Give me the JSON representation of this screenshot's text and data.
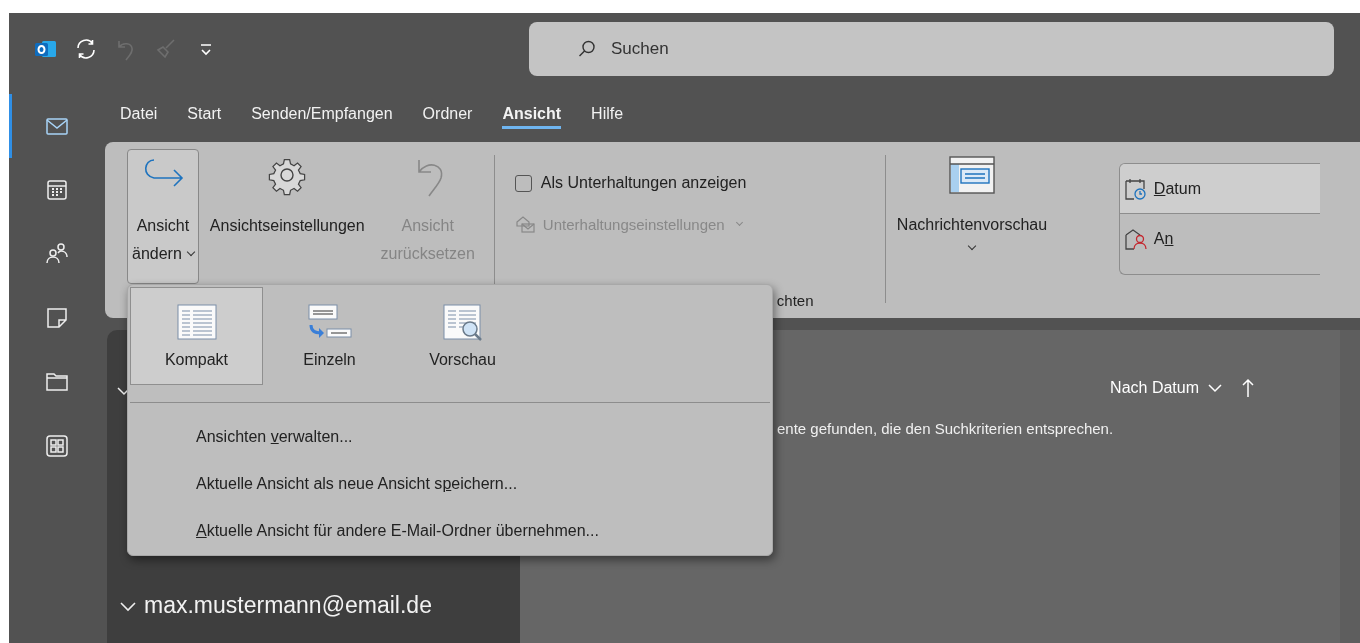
{
  "title_bar": {
    "quick_access": [
      {
        "kind": "sync",
        "disabled": false
      },
      {
        "kind": "undo",
        "disabled": true
      },
      {
        "kind": "brush",
        "disabled": true
      },
      {
        "kind": "customize",
        "disabled": false
      }
    ],
    "search": {
      "placeholder": "Suchen"
    }
  },
  "nav": [
    {
      "kind": "mail",
      "selected": true
    },
    {
      "kind": "calendar",
      "selected": false
    },
    {
      "kind": "people",
      "selected": false
    },
    {
      "kind": "notes",
      "selected": false
    },
    {
      "kind": "folder",
      "selected": false
    },
    {
      "kind": "apps",
      "selected": false
    }
  ],
  "menu_tabs": [
    {
      "label": "Datei",
      "selected": false
    },
    {
      "label": "Start",
      "selected": false
    },
    {
      "label": "Senden/Empfangen",
      "selected": false
    },
    {
      "label": "Ordner",
      "selected": false
    },
    {
      "label": "Ansicht",
      "selected": true
    },
    {
      "label": "Hilfe",
      "selected": false
    }
  ],
  "ribbon": {
    "view_buttons": [
      {
        "kind": "change",
        "lines": [
          "Ansicht",
          "ändern"
        ],
        "dropdown": true,
        "pressed": true,
        "disabled": false
      },
      {
        "kind": "settings",
        "lines": [
          "Ansichtseinstellungen"
        ],
        "dropdown": false,
        "pressed": false,
        "disabled": false
      },
      {
        "kind": "reset",
        "lines": [
          "Ansicht",
          "zurücksetzen"
        ],
        "dropdown": false,
        "pressed": false,
        "disabled": true
      }
    ],
    "conversations": {
      "checkbox": {
        "label": "Als Unterhaltungen anzeigen",
        "checked": false
      },
      "settings": {
        "label": "Unterhaltungseinstellungen",
        "disabled": true
      },
      "group_label": "chten"
    },
    "preview": {
      "label": "Nachrichtenvorschau"
    },
    "arrangement": [
      {
        "kind": "date",
        "label": {
          "key": "D",
          "after": "atum"
        },
        "selected": true
      },
      {
        "kind": "to",
        "label": {
          "before": "A",
          "key": "n"
        },
        "selected": false
      }
    ]
  },
  "view_menu": {
    "gallery": [
      {
        "kind": "compact",
        "label": "Kompakt",
        "selected": true
      },
      {
        "kind": "single",
        "label": "Einzeln",
        "selected": false
      },
      {
        "kind": "preview",
        "label": "Vorschau",
        "selected": false
      }
    ],
    "items": [
      {
        "label": {
          "before": "Ansichten ",
          "key": "v",
          "after": "erwalten..."
        }
      },
      {
        "label": {
          "before": "Aktuelle Ansicht als neue Ansicht s",
          "key": "p",
          "after": "eichern..."
        }
      },
      {
        "label": {
          "key": "A",
          "after": "ktuelle Ansicht für andere E-Mail-Ordner übernehmen..."
        }
      }
    ]
  },
  "folder_pane": {
    "account": "max.mustermann@email.de"
  },
  "message_list": {
    "sort": "Nach Datum",
    "message": "ente gefunden, die den Suchkriterien entsprechen."
  }
}
